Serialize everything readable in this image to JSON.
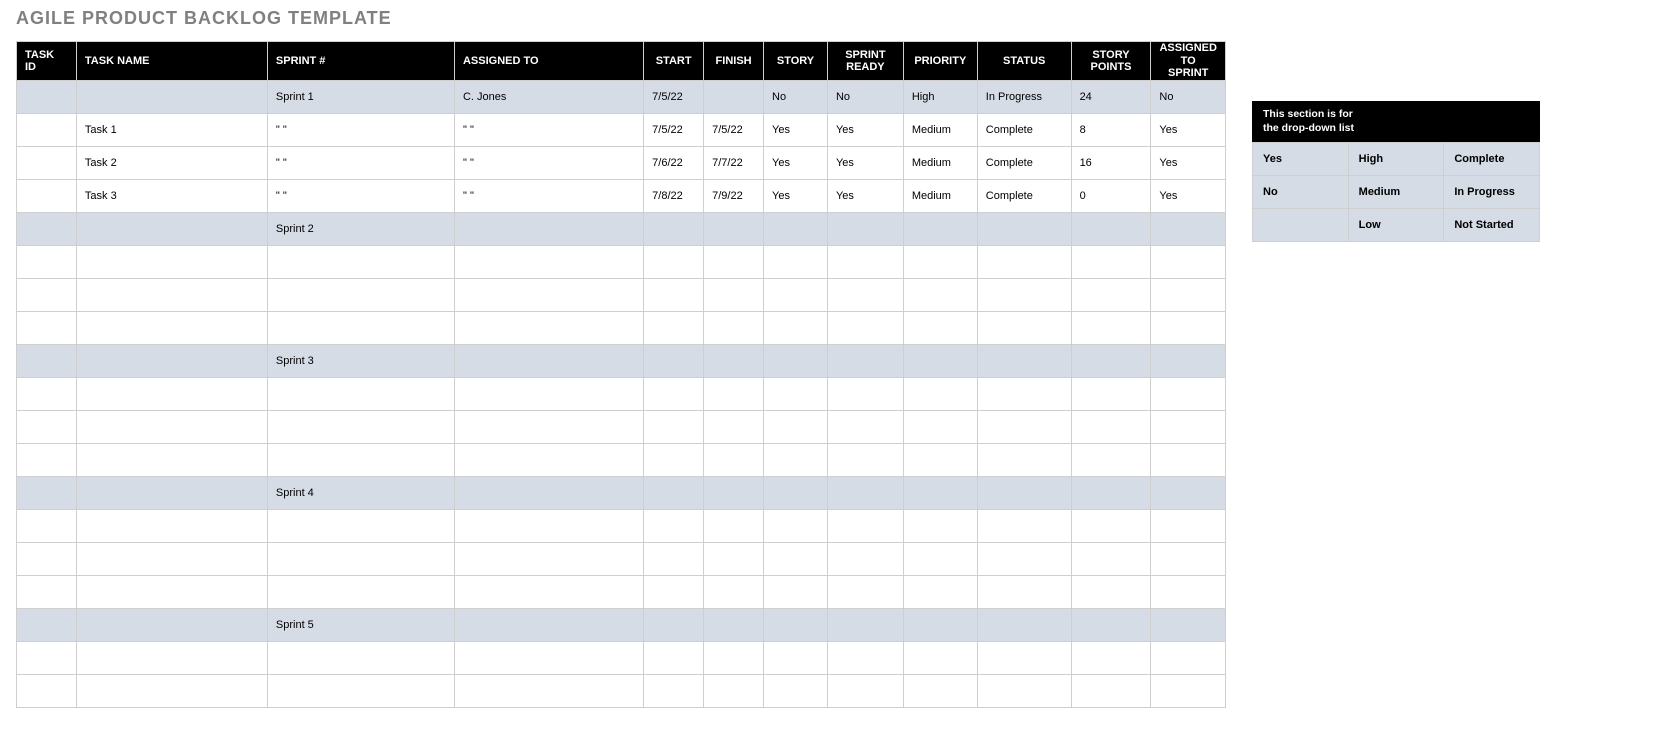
{
  "title": "AGILE PRODUCT BACKLOG TEMPLATE",
  "headers": {
    "task_id": "TASK ID",
    "task_name": "TASK NAME",
    "sprint": "SPRINT #",
    "assigned_to": "ASSIGNED TO",
    "start": "START",
    "finish": "FINISH",
    "story": "STORY",
    "sprint_ready": "SPRINT READY",
    "priority": "PRIORITY",
    "status": "STATUS",
    "story_points": "STORY POINTS",
    "assigned_sprint_l1": "ASSIGNED",
    "assigned_sprint_l2": "TO SPRINT"
  },
  "rows": [
    {
      "type": "sprint",
      "task_id": "",
      "task_name": "",
      "sprint": "Sprint 1",
      "assigned_to": "C. Jones",
      "start": "7/5/22",
      "finish": "",
      "story": "No",
      "sprint_ready": "No",
      "priority": "High",
      "status": "In Progress",
      "story_points": "24",
      "assigned_sprint": "No"
    },
    {
      "type": "task",
      "task_id": "",
      "task_name": "Task 1",
      "sprint": "\" \"",
      "assigned_to": "\" \"",
      "start": "7/5/22",
      "finish": "7/5/22",
      "story": "Yes",
      "sprint_ready": "Yes",
      "priority": "Medium",
      "status": "Complete",
      "story_points": "8",
      "assigned_sprint": "Yes"
    },
    {
      "type": "task",
      "task_id": "",
      "task_name": "Task 2",
      "sprint": "\" \"",
      "assigned_to": "\" \"",
      "start": "7/6/22",
      "finish": "7/7/22",
      "story": "Yes",
      "sprint_ready": "Yes",
      "priority": "Medium",
      "status": "Complete",
      "story_points": "16",
      "assigned_sprint": "Yes"
    },
    {
      "type": "task",
      "task_id": "",
      "task_name": "Task 3",
      "sprint": "\" \"",
      "assigned_to": "\" \"",
      "start": "7/8/22",
      "finish": "7/9/22",
      "story": "Yes",
      "sprint_ready": "Yes",
      "priority": "Medium",
      "status": "Complete",
      "story_points": "0",
      "assigned_sprint": "Yes"
    },
    {
      "type": "sprint",
      "task_id": "",
      "task_name": "",
      "sprint": "Sprint 2",
      "assigned_to": "",
      "start": "",
      "finish": "",
      "story": "",
      "sprint_ready": "",
      "priority": "",
      "status": "",
      "story_points": "",
      "assigned_sprint": ""
    },
    {
      "type": "task",
      "task_id": "",
      "task_name": "",
      "sprint": "",
      "assigned_to": "",
      "start": "",
      "finish": "",
      "story": "",
      "sprint_ready": "",
      "priority": "",
      "status": "",
      "story_points": "",
      "assigned_sprint": ""
    },
    {
      "type": "task",
      "task_id": "",
      "task_name": "",
      "sprint": "",
      "assigned_to": "",
      "start": "",
      "finish": "",
      "story": "",
      "sprint_ready": "",
      "priority": "",
      "status": "",
      "story_points": "",
      "assigned_sprint": ""
    },
    {
      "type": "task",
      "task_id": "",
      "task_name": "",
      "sprint": "",
      "assigned_to": "",
      "start": "",
      "finish": "",
      "story": "",
      "sprint_ready": "",
      "priority": "",
      "status": "",
      "story_points": "",
      "assigned_sprint": ""
    },
    {
      "type": "sprint",
      "task_id": "",
      "task_name": "",
      "sprint": "Sprint 3",
      "assigned_to": "",
      "start": "",
      "finish": "",
      "story": "",
      "sprint_ready": "",
      "priority": "",
      "status": "",
      "story_points": "",
      "assigned_sprint": ""
    },
    {
      "type": "task",
      "task_id": "",
      "task_name": "",
      "sprint": "",
      "assigned_to": "",
      "start": "",
      "finish": "",
      "story": "",
      "sprint_ready": "",
      "priority": "",
      "status": "",
      "story_points": "",
      "assigned_sprint": ""
    },
    {
      "type": "task",
      "task_id": "",
      "task_name": "",
      "sprint": "",
      "assigned_to": "",
      "start": "",
      "finish": "",
      "story": "",
      "sprint_ready": "",
      "priority": "",
      "status": "",
      "story_points": "",
      "assigned_sprint": ""
    },
    {
      "type": "task",
      "task_id": "",
      "task_name": "",
      "sprint": "",
      "assigned_to": "",
      "start": "",
      "finish": "",
      "story": "",
      "sprint_ready": "",
      "priority": "",
      "status": "",
      "story_points": "",
      "assigned_sprint": ""
    },
    {
      "type": "sprint",
      "task_id": "",
      "task_name": "",
      "sprint": "Sprint 4",
      "assigned_to": "",
      "start": "",
      "finish": "",
      "story": "",
      "sprint_ready": "",
      "priority": "",
      "status": "",
      "story_points": "",
      "assigned_sprint": ""
    },
    {
      "type": "task",
      "task_id": "",
      "task_name": "",
      "sprint": "",
      "assigned_to": "",
      "start": "",
      "finish": "",
      "story": "",
      "sprint_ready": "",
      "priority": "",
      "status": "",
      "story_points": "",
      "assigned_sprint": ""
    },
    {
      "type": "task",
      "task_id": "",
      "task_name": "",
      "sprint": "",
      "assigned_to": "",
      "start": "",
      "finish": "",
      "story": "",
      "sprint_ready": "",
      "priority": "",
      "status": "",
      "story_points": "",
      "assigned_sprint": ""
    },
    {
      "type": "task",
      "task_id": "",
      "task_name": "",
      "sprint": "",
      "assigned_to": "",
      "start": "",
      "finish": "",
      "story": "",
      "sprint_ready": "",
      "priority": "",
      "status": "",
      "story_points": "",
      "assigned_sprint": ""
    },
    {
      "type": "sprint",
      "task_id": "",
      "task_name": "",
      "sprint": "Sprint 5",
      "assigned_to": "",
      "start": "",
      "finish": "",
      "story": "",
      "sprint_ready": "",
      "priority": "",
      "status": "",
      "story_points": "",
      "assigned_sprint": ""
    },
    {
      "type": "task",
      "task_id": "",
      "task_name": "",
      "sprint": "",
      "assigned_to": "",
      "start": "",
      "finish": "",
      "story": "",
      "sprint_ready": "",
      "priority": "",
      "status": "",
      "story_points": "",
      "assigned_sprint": ""
    },
    {
      "type": "task",
      "task_id": "",
      "task_name": "",
      "sprint": "",
      "assigned_to": "",
      "start": "",
      "finish": "",
      "story": "",
      "sprint_ready": "",
      "priority": "",
      "status": "",
      "story_points": "",
      "assigned_sprint": ""
    }
  ],
  "sidebar": {
    "head_l1": "This section is for",
    "head_l2": "the drop-down list",
    "grid": [
      [
        "Yes",
        "High",
        "Complete"
      ],
      [
        "No",
        "Medium",
        "In Progress"
      ],
      [
        "",
        "Low",
        "Not Started"
      ]
    ]
  }
}
